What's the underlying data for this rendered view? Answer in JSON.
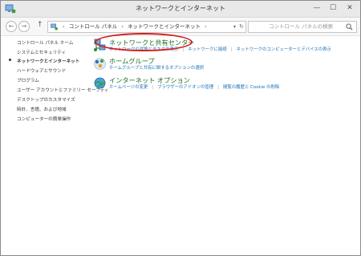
{
  "window": {
    "title": "ネットワークとインターネット",
    "minimize_glyph": "—",
    "maximize_glyph": "☐",
    "close_glyph": "✕"
  },
  "address": {
    "icon": "control-panel-icon",
    "crumbs": [
      "コントロール パネル",
      "ネットワークとインターネット"
    ],
    "separator": "›",
    "back_glyph": "←",
    "forward_glyph": "→",
    "up_glyph": "↑",
    "dropdown_glyph": "▾",
    "refresh_glyph": "↻"
  },
  "search": {
    "placeholder": "コントロール パネルの検索",
    "icon": "search-icon"
  },
  "sidebar": {
    "home": "コントロール パネル ホーム",
    "items": [
      {
        "label": "システムとセキュリティ",
        "active": false
      },
      {
        "label": "ネットワークとインターネット",
        "active": true
      },
      {
        "label": "ハードウェアとサウンド",
        "active": false
      },
      {
        "label": "プログラム",
        "active": false
      },
      {
        "label": "ユーザー アカウントとファミリー セーフティ",
        "active": false
      },
      {
        "label": "デスクトップのカスタマイズ",
        "active": false
      },
      {
        "label": "時計、言語、および地域",
        "active": false
      },
      {
        "label": "コンピューターの簡単操作",
        "active": false
      }
    ]
  },
  "categories": [
    {
      "title": "ネットワークと共有センター",
      "icon": "network-sharing-center-icon",
      "links": [
        "ネットワークの状態とタスクの表示",
        "ネットワークに接続",
        "ネットワークのコンピューターとデバイスの表示"
      ]
    },
    {
      "title": "ホームグループ",
      "icon": "homegroup-icon",
      "links": [
        "ホームグループと共有に関するオプションの選択"
      ]
    },
    {
      "title": "インターネット オプション",
      "icon": "internet-options-icon",
      "links": [
        "ホームページの変更",
        "ブラウザーのアドオンの管理",
        "閲覧の履歴と Cookie の削除"
      ]
    }
  ],
  "colors": {
    "category_title": "#1e6b23",
    "link": "#1d72b8",
    "highlight_ring": "#d71a1a"
  }
}
